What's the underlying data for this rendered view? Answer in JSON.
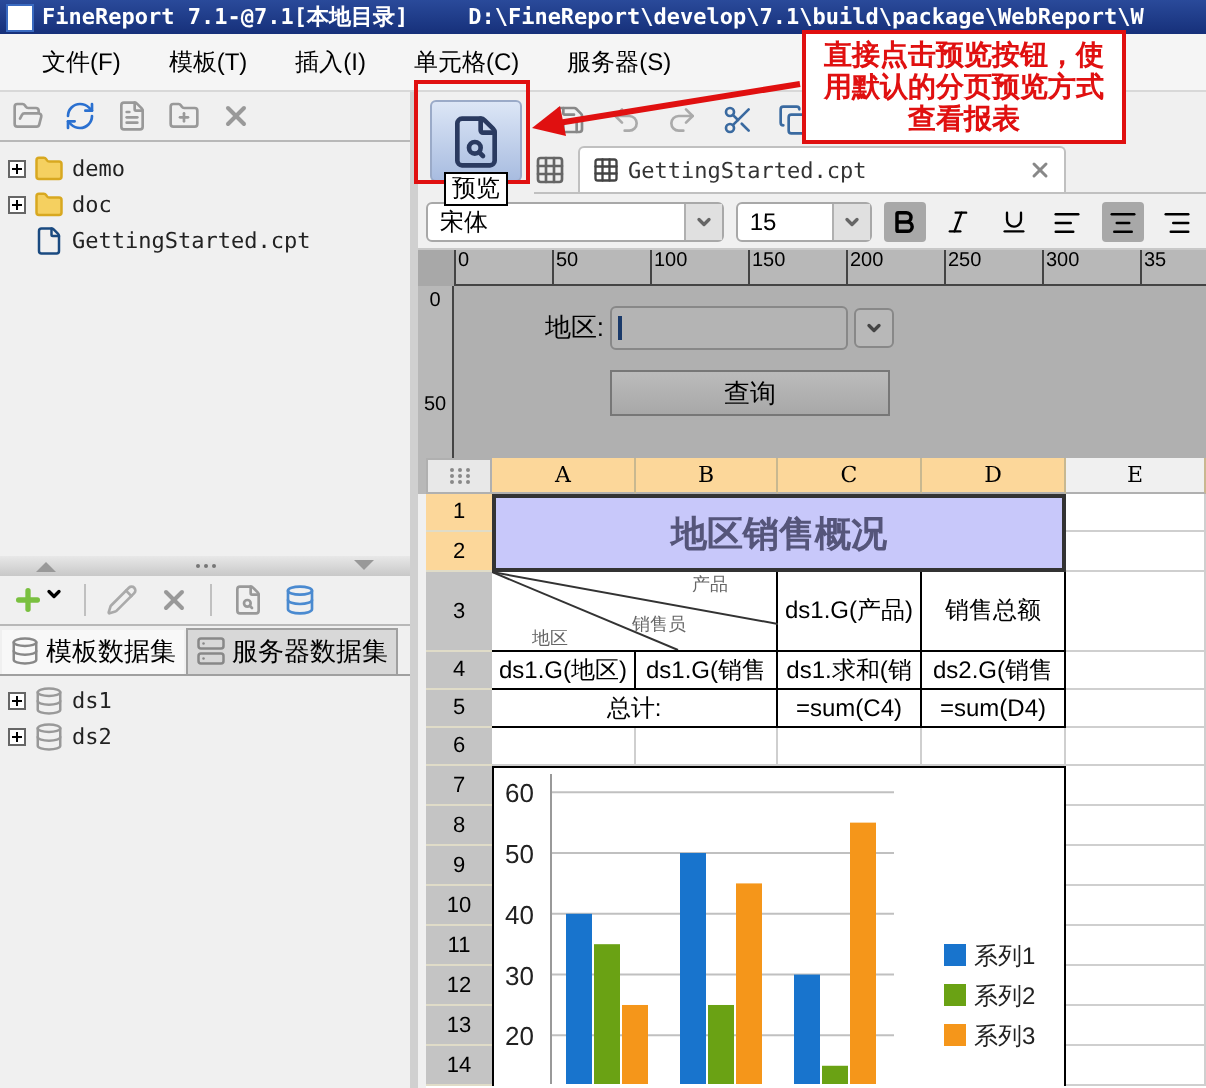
{
  "window": {
    "title": "FineReport 7.1-@7.1[本地目录]",
    "path": "D:\\FineReport\\develop\\7.1\\build\\package\\WebReport\\W"
  },
  "menu": [
    "文件(F)",
    "模板(T)",
    "插入(I)",
    "单元格(C)",
    "服务器(S)"
  ],
  "file_tree": [
    {
      "label": "demo",
      "kind": "folder",
      "expanded": false
    },
    {
      "label": "doc",
      "kind": "folder",
      "expanded": false
    },
    {
      "label": "GettingStarted.cpt",
      "kind": "file"
    }
  ],
  "preview": {
    "tooltip": "预览"
  },
  "document_tabs": [
    {
      "label": "GettingStarted.cpt",
      "selected": true
    }
  ],
  "format": {
    "font": "宋体",
    "size": "15",
    "bold": true,
    "italic": false,
    "underline": false,
    "alignment_buttons": [
      {
        "kind": "left",
        "selected": false
      },
      {
        "kind": "center",
        "selected": true
      },
      {
        "kind": "right",
        "selected": false
      }
    ]
  },
  "ruler": {
    "horizontal": [
      "0",
      "50",
      "100",
      "150",
      "200",
      "250",
      "300",
      "35"
    ],
    "vertical": [
      "0",
      "50"
    ]
  },
  "parameter_form": {
    "label": "地区:",
    "button": "查询"
  },
  "sheet": {
    "columns": [
      {
        "label": "A",
        "selected": true
      },
      {
        "label": "B",
        "selected": true
      },
      {
        "label": "C",
        "selected": true
      },
      {
        "label": "D",
        "selected": true
      },
      {
        "label": "E",
        "selected": false
      }
    ],
    "rows": [
      {
        "label": "1",
        "selected": true
      },
      {
        "label": "2",
        "selected": true
      },
      {
        "label": "3",
        "selected": false
      },
      {
        "label": "4",
        "selected": false
      },
      {
        "label": "5",
        "selected": false
      },
      {
        "label": "6",
        "selected": false
      },
      {
        "label": "7",
        "selected": false
      },
      {
        "label": "8",
        "selected": false
      },
      {
        "label": "9",
        "selected": false
      },
      {
        "label": "10",
        "selected": false
      },
      {
        "label": "11",
        "selected": false
      },
      {
        "label": "12",
        "selected": false
      },
      {
        "label": "13",
        "selected": false
      },
      {
        "label": "14",
        "selected": false
      }
    ],
    "title": "地区销售概况",
    "diagonal_header": {
      "top": "产品",
      "middle": "销售员",
      "bottom": "地区"
    },
    "header_cells": [
      "ds1.G(产品)",
      "销售总额"
    ],
    "data_cells": [
      "ds1.G(地区)",
      "ds1.G(销售",
      "ds1.求和(销",
      "ds2.G(销售"
    ],
    "total_label": "总计:",
    "total_cells": [
      "=sum(C4)",
      "=sum(D4)"
    ],
    "chart_data": {
      "type": "bar",
      "ylim": [
        12,
        63
      ],
      "yticks": [
        20,
        30,
        40,
        50,
        60
      ],
      "grid": true,
      "legend": "right",
      "series": [
        {
          "name": "系列1",
          "color": "#1874cd",
          "values": [
            40,
            50,
            30
          ]
        },
        {
          "name": "系列2",
          "color": "#6aa214",
          "values": [
            35,
            25,
            15
          ]
        },
        {
          "name": "系列3",
          "color": "#f5961a",
          "values": [
            25,
            45,
            55
          ]
        }
      ]
    }
  },
  "dataset_tabs": [
    {
      "label": "模板数据集",
      "selected": true
    },
    {
      "label": "服务器数据集",
      "selected": false
    }
  ],
  "datasets": [
    {
      "label": "ds1",
      "expanded": false
    },
    {
      "label": "ds2",
      "expanded": false
    }
  ],
  "annotation": "直接点击预览按钮，使用默认的分页预览方式查看报表"
}
